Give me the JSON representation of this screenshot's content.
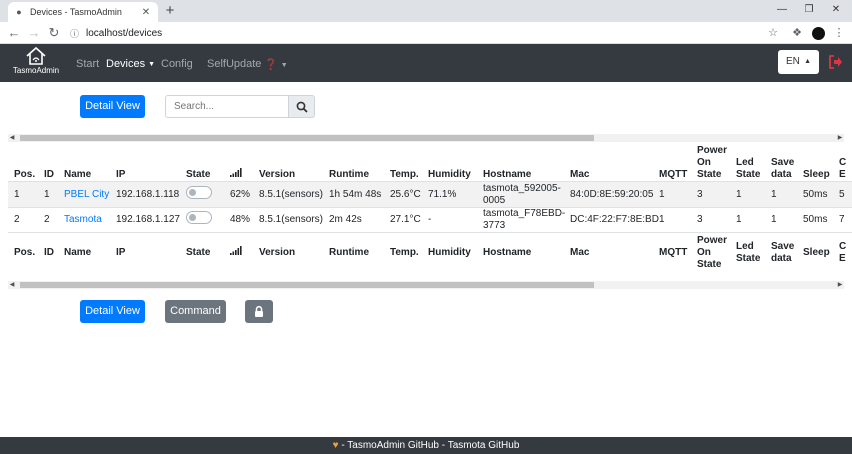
{
  "browser": {
    "tab_title": "Devices - TasmoAdmin",
    "url": "localhost/devices"
  },
  "navbar": {
    "brand": "TasmoAdmin",
    "links": {
      "start": "Start",
      "devices": "Devices",
      "config": "Config",
      "selfupdate": "SelfUpdate"
    },
    "language": "EN"
  },
  "toolbar": {
    "detail_view": "Detail View",
    "search_placeholder": "Search...",
    "command": "Command"
  },
  "table": {
    "headers": {
      "pos": "Pos.",
      "id": "ID",
      "name": "Name",
      "ip": "IP",
      "state": "State",
      "version": "Version",
      "runtime": "Runtime",
      "temp": "Temp.",
      "humidity": "Humidity",
      "hostname": "Hostname",
      "mac": "Mac",
      "mqtt": "MQTT",
      "power_on_1": "Power",
      "power_on_2": "On",
      "power_on_3": "State",
      "led_1": "Led",
      "led_2": "State",
      "save_1": "Save",
      "save_2": "data",
      "sleep": "Sleep",
      "cut1": "C",
      "cut2": "E"
    },
    "rows": [
      {
        "pos": "1",
        "id": "1",
        "name": "PBEL City",
        "ip": "192.168.1.118",
        "signal": "62%",
        "version": "8.5.1(sensors)",
        "runtime": "1h 54m 48s",
        "temp": "25.6°C",
        "humidity": "71.1%",
        "hostname_1": "tasmota_592005-",
        "hostname_2": "0005",
        "mac": "84:0D:8E:59:20:05",
        "mqtt": "1",
        "power_on": "3",
        "led": "1",
        "save": "1",
        "sleep": "50ms",
        "cut": "5"
      },
      {
        "pos": "2",
        "id": "2",
        "name": "Tasmota",
        "ip": "192.168.1.127",
        "signal": "48%",
        "version": "8.5.1(sensors)",
        "runtime": "2m 42s",
        "temp": "27.1°C",
        "humidity": "-",
        "hostname_1": "tasmota_F78EBD-",
        "hostname_2": "3773",
        "mac": "DC:4F:22:F7:8E:BD",
        "mqtt": "1",
        "power_on": "3",
        "led": "1",
        "save": "1",
        "sleep": "50ms",
        "cut": "7"
      }
    ]
  },
  "footer": {
    "tasmoadmin_github": "TasmoAdmin GitHub",
    "separator": "-",
    "tasmota_github": "Tasmota GitHub"
  },
  "colors": {
    "navbar": "#343a40",
    "primary": "#007bff",
    "secondary": "#6c757d",
    "logout": "#dc3545"
  }
}
